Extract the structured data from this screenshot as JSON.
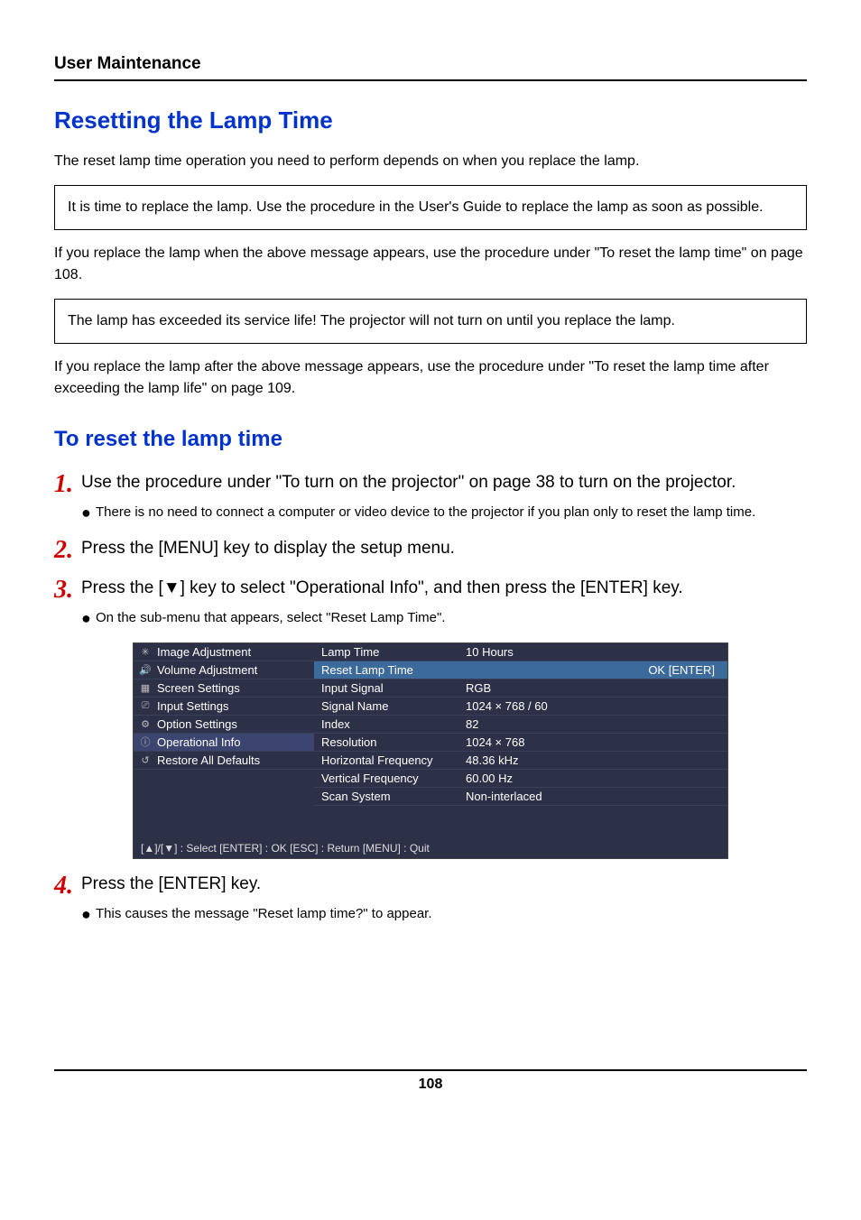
{
  "header": {
    "title": "User Maintenance"
  },
  "h2": "Resetting the Lamp Time",
  "intro": "The reset lamp time operation you need to perform depends on when you replace the lamp.",
  "box1": "It is time to replace the lamp. Use the procedure in the User's Guide to replace the lamp as soon as possible.",
  "after_box1": "If you replace the lamp when the above message appears, use the procedure under \"To reset the lamp time\" on page 108.",
  "box2": "The lamp has exceeded its service life! The projector will not turn on until you replace the lamp.",
  "after_box2": "If you replace the lamp after the above message appears, use the procedure under \"To reset the lamp time after exceeding the lamp life\" on page 109.",
  "h3": "To reset the lamp time",
  "steps": {
    "s1": {
      "num": "1.",
      "text": "Use the procedure under \"To turn on the projector\" on page 38 to turn on the projector.",
      "bullet": "There is no need to connect a computer or video device to the projector if you plan only to reset the lamp time."
    },
    "s2": {
      "num": "2.",
      "text": "Press the [MENU] key to display the setup menu."
    },
    "s3": {
      "num": "3.",
      "text": "Press the [▼] key to select \"Operational Info\", and then press the [ENTER] key.",
      "bullet": "On the sub-menu that appears, select \"Reset Lamp Time\"."
    },
    "s4": {
      "num": "4.",
      "text": "Press the [ENTER] key.",
      "bullet": "This causes the message \"Reset lamp time?\" to appear."
    }
  },
  "osd": {
    "left_items": [
      {
        "icon": "sun-icon",
        "label": "Image Adjustment"
      },
      {
        "icon": "speaker-icon",
        "label": "Volume Adjustment"
      },
      {
        "icon": "screen-icon",
        "label": "Screen Settings"
      },
      {
        "icon": "sliders-icon",
        "label": "Input Settings"
      },
      {
        "icon": "options-icon",
        "label": "Option Settings"
      },
      {
        "icon": "info-icon",
        "label": "Operational Info"
      },
      {
        "icon": "restore-icon",
        "label": "Restore All Defaults"
      }
    ],
    "right_rows": [
      {
        "lab": "Lamp Time",
        "val": "10      Hours"
      },
      {
        "lab": "Reset Lamp Time",
        "val": "",
        "ok": "OK [ENTER]"
      },
      {
        "lab": "Input Signal",
        "val": "RGB"
      },
      {
        "lab": "Signal Name",
        "val": "1024 × 768 / 60"
      },
      {
        "lab": "Index",
        "val": "82"
      },
      {
        "lab": "Resolution",
        "val": "1024 × 768"
      },
      {
        "lab": "Horizontal Frequency",
        "val": "48.36 kHz"
      },
      {
        "lab": "Vertical Frequency",
        "val": "60.00 Hz"
      },
      {
        "lab": "Scan System",
        "val": "Non-interlaced"
      }
    ],
    "footer": "[▲]/[▼] : Select    [ENTER] : OK    [ESC] : Return    [MENU] : Quit"
  },
  "page_number": "108"
}
